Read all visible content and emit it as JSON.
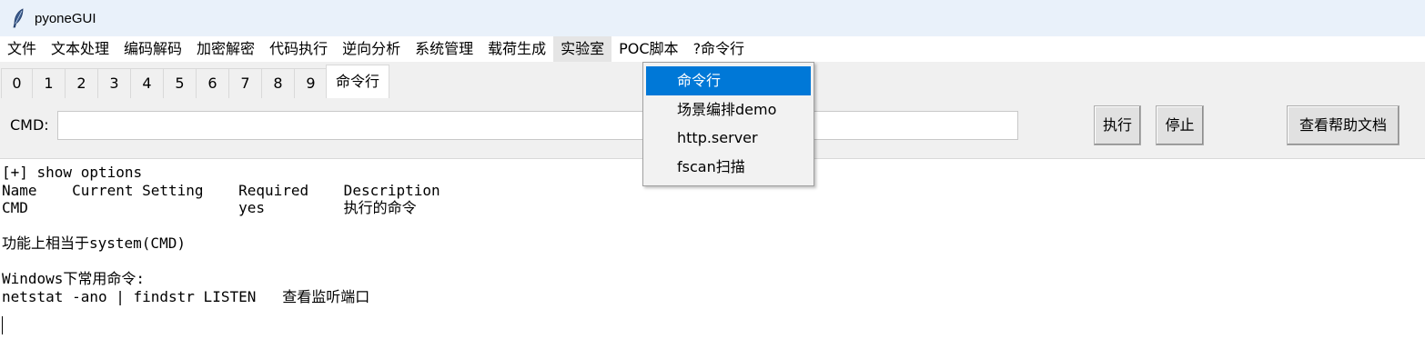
{
  "window": {
    "title": "pyoneGUI",
    "icon": "feather-icon"
  },
  "menubar": {
    "items": [
      "文件",
      "文本处理",
      "编码解码",
      "加密解密",
      "代码执行",
      "逆向分析",
      "系统管理",
      "载荷生成",
      "实验室",
      "POC脚本",
      "?命令行"
    ],
    "active_index": 8
  },
  "tabs": {
    "items": [
      "0",
      "1",
      "2",
      "3",
      "4",
      "5",
      "6",
      "7",
      "8",
      "9",
      "命令行"
    ],
    "selected_index": 10
  },
  "cmd_panel": {
    "label": "CMD:",
    "input_value": "",
    "run_label": "执行",
    "stop_label": "停止",
    "help_label": "查看帮助文档"
  },
  "output": {
    "lines": [
      "[+] show options",
      "Name    Current Setting    Required    Description",
      "CMD                        yes         执行的命令",
      "",
      "功能上相当于system(CMD)",
      "",
      "Windows下常用命令:",
      "netstat -ano | findstr LISTEN   查看监听端口"
    ]
  },
  "dropdown": {
    "items": [
      "命令行",
      "场景编排demo",
      "http.server",
      "fscan扫描"
    ],
    "highlighted_index": 0
  },
  "colors": {
    "titlebar_bg": "#e9f1fa",
    "panel_bg": "#f0f0f0",
    "highlight": "#0078d7"
  }
}
